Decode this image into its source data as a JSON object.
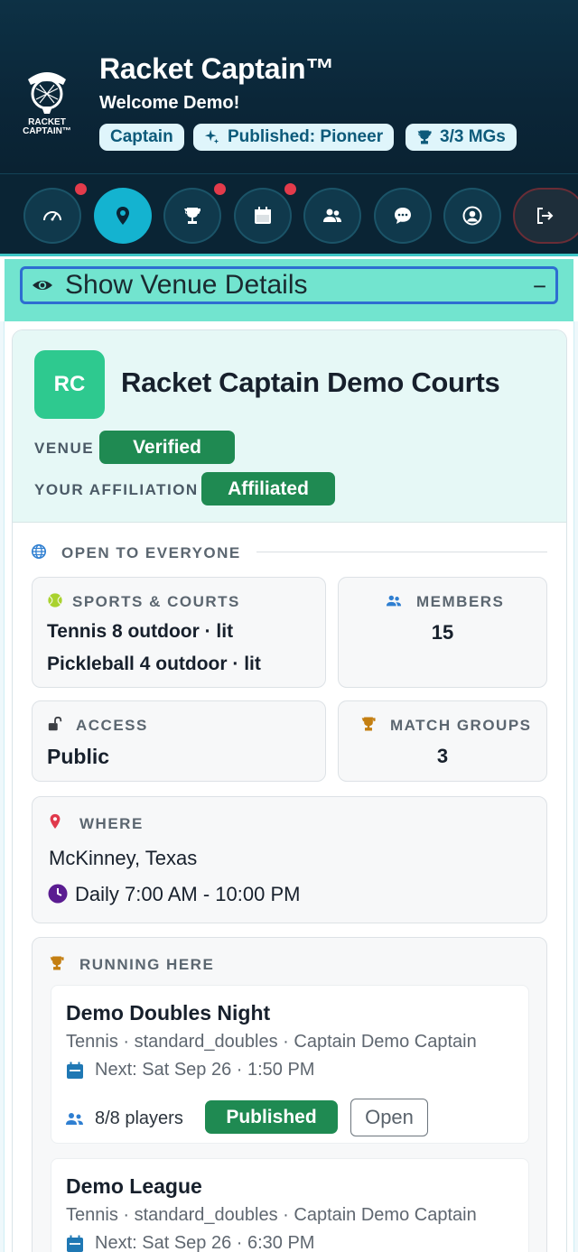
{
  "header": {
    "app_title": "Racket Captain™",
    "welcome": "Welcome Demo!",
    "logo_text": "RACKET CAPTAIN™",
    "badges": [
      {
        "label": "Captain",
        "icon": "none"
      },
      {
        "label": "Published: Pioneer",
        "icon": "sparkle-icon"
      },
      {
        "label": "3/3 MGs",
        "icon": "trophy-icon"
      }
    ]
  },
  "nav": {
    "items": [
      {
        "name": "dashboard",
        "icon": "speedometer-icon",
        "notification": true
      },
      {
        "name": "venues",
        "icon": "location-pin-icon",
        "active": true
      },
      {
        "name": "match-groups",
        "icon": "trophy-icon",
        "notification": true
      },
      {
        "name": "calendar",
        "icon": "calendar-icon",
        "notification": true
      },
      {
        "name": "players",
        "icon": "people-icon"
      },
      {
        "name": "messages",
        "icon": "chat-icon"
      },
      {
        "name": "profile",
        "icon": "user-circle-icon"
      },
      {
        "name": "logout",
        "icon": "logout-icon"
      }
    ]
  },
  "toggle": {
    "label": "Show Venue Details",
    "collapse_symbol": "−"
  },
  "venue": {
    "initials": "RC",
    "name": "Racket Captain Demo Courts",
    "venue_label": "VENUE",
    "venue_status": "Verified",
    "affiliation_label": "YOUR AFFILIATION",
    "affiliation_status": "Affiliated",
    "openness": "OPEN TO EVERYONE",
    "sports": {
      "label": "SPORTS & COURTS",
      "lines": [
        "Tennis 8 outdoor · lit",
        "Pickleball 4 outdoor · lit"
      ]
    },
    "members": {
      "label": "MEMBERS",
      "value": "15"
    },
    "access": {
      "label": "ACCESS",
      "value": "Public"
    },
    "match_groups": {
      "label": "MATCH GROUPS",
      "value": "3"
    },
    "where": {
      "label": "WHERE",
      "location": "McKinney, Texas",
      "hours": "Daily 7:00 AM - 10:00 PM"
    },
    "running": {
      "label": "RUNNING HERE",
      "items": [
        {
          "title": "Demo Doubles Night",
          "meta": "Tennis · standard_doubles · Captain Demo Captain",
          "next": "Next: Sat Sep 26 · 1:50 PM",
          "players": "8/8 players",
          "status": "Published",
          "action": "Open"
        },
        {
          "title": "Demo League",
          "meta": "Tennis · standard_doubles · Captain Demo Captain",
          "next": "Next: Sat Sep 26 · 6:30 PM"
        }
      ]
    }
  },
  "colors": {
    "header_bg": "#0b2638",
    "accent_teal": "#14b3d0",
    "toggle_bg": "#72e4cf",
    "success_green": "#1f8a52",
    "notification_red": "#e33b4b"
  }
}
